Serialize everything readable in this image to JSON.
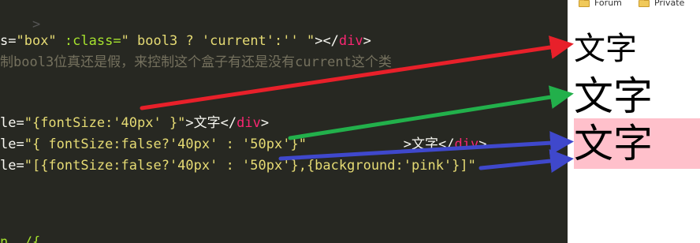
{
  "editor": {
    "line0": {
      "a": ">"
    },
    "line1": {
      "a": "s=",
      "b": "\"box\"",
      "c": " :class=",
      "d": "\" bool3 ? 'current':'' \"",
      "e": "></",
      "f": "div",
      "g": ">"
    },
    "line2": {
      "a": "制bool3位真还是假，来控制这个盒子有还是没有current这个类"
    },
    "line3": {
      "a": "le=",
      "b": "\"{fontSize:'40px' }\"",
      "c": ">文字</",
      "d": "div",
      "e": ">"
    },
    "line4": {
      "a": "le=",
      "b": "\"{ fontSize:false?'40px' : '50px'}\"",
      "c": "            >文字</",
      "d": "div",
      "e": ">"
    },
    "line5": {
      "a": "le=",
      "b": "\"[{fontSize:false?'40px' : '50px'},{background:'pink'}]\""
    },
    "line6": {
      "a": "n  /{"
    }
  },
  "browser": {
    "bookmarks": [
      {
        "label": "Forum",
        "icon": "folder-icon"
      },
      {
        "label": "Private",
        "icon": "folder-icon"
      }
    ],
    "outputs": [
      {
        "text": "文字",
        "font_size": "40px"
      },
      {
        "text": "文字",
        "font_size": "50px"
      },
      {
        "text": "文字",
        "font_size": "50px",
        "background": "pink"
      }
    ]
  },
  "colors": {
    "editor_bg": "#272822",
    "string": "#e6db74",
    "tag": "#f92672",
    "comment": "#75715e",
    "arrow_red": "#e8202a",
    "arrow_green": "#22b04b",
    "arrow_blue": "#3f48cc",
    "pink_box": "#ffc0cb"
  }
}
